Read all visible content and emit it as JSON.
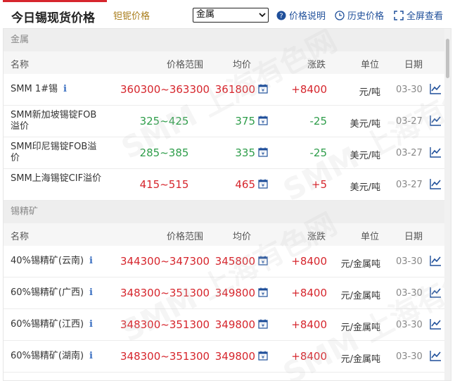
{
  "header": {
    "title": "今日锡现货价格",
    "second_tab": "钽铌价格",
    "select_value": "金属",
    "price_help": "价格说明",
    "history": "历史价格",
    "fullscreen": "全屏查看"
  },
  "columns": {
    "name": "名称",
    "range": "价格范围",
    "avg": "均价",
    "change": "涨跌",
    "unit": "单位",
    "date": "日期"
  },
  "sections": [
    {
      "title": "金属",
      "rows": [
        {
          "name": "SMM 1#锡",
          "info": true,
          "range": "360300~363300",
          "avg": "361800",
          "change": "+8400",
          "dir": "up",
          "unit": "元/吨",
          "date": "03-30"
        },
        {
          "name": "SMM新加坡锡锭FOB溢价",
          "info": false,
          "range": "325~425",
          "avg": "375",
          "change": "-25",
          "dir": "down",
          "unit": "美元/吨",
          "date": "03-27"
        },
        {
          "name": "SMM印尼锡锭FOB溢价",
          "info": false,
          "range": "285~385",
          "avg": "335",
          "change": "-25",
          "dir": "down",
          "unit": "美元/吨",
          "date": "03-27"
        },
        {
          "name": "SMM上海锡锭CIF溢价",
          "info": false,
          "range": "415~515",
          "avg": "465",
          "change": "+5",
          "dir": "up",
          "unit": "美元/吨",
          "date": "03-27"
        }
      ]
    },
    {
      "title": "锡精矿",
      "rows": [
        {
          "name": "40%锡精矿(云南)",
          "info": true,
          "range": "344300~347300",
          "avg": "345800",
          "change": "+8400",
          "dir": "up",
          "unit": "元/金属吨",
          "date": "03-30"
        },
        {
          "name": "60%锡精矿(广西)",
          "info": true,
          "range": "348300~351300",
          "avg": "349800",
          "change": "+8400",
          "dir": "up",
          "unit": "元/金属吨",
          "date": "03-30"
        },
        {
          "name": "60%锡精矿(江西)",
          "info": true,
          "range": "348300~351300",
          "avg": "349800",
          "change": "+8400",
          "dir": "up",
          "unit": "元/金属吨",
          "date": "03-30"
        },
        {
          "name": "60%锡精矿(湖南)",
          "info": true,
          "range": "348300~351300",
          "avg": "349800",
          "change": "+8400",
          "dir": "up",
          "unit": "元/金属吨",
          "date": "03-30"
        }
      ]
    }
  ],
  "colors": {
    "up": "#d6262d",
    "down": "#2e9d4a",
    "accent": "#1f4f9a"
  }
}
